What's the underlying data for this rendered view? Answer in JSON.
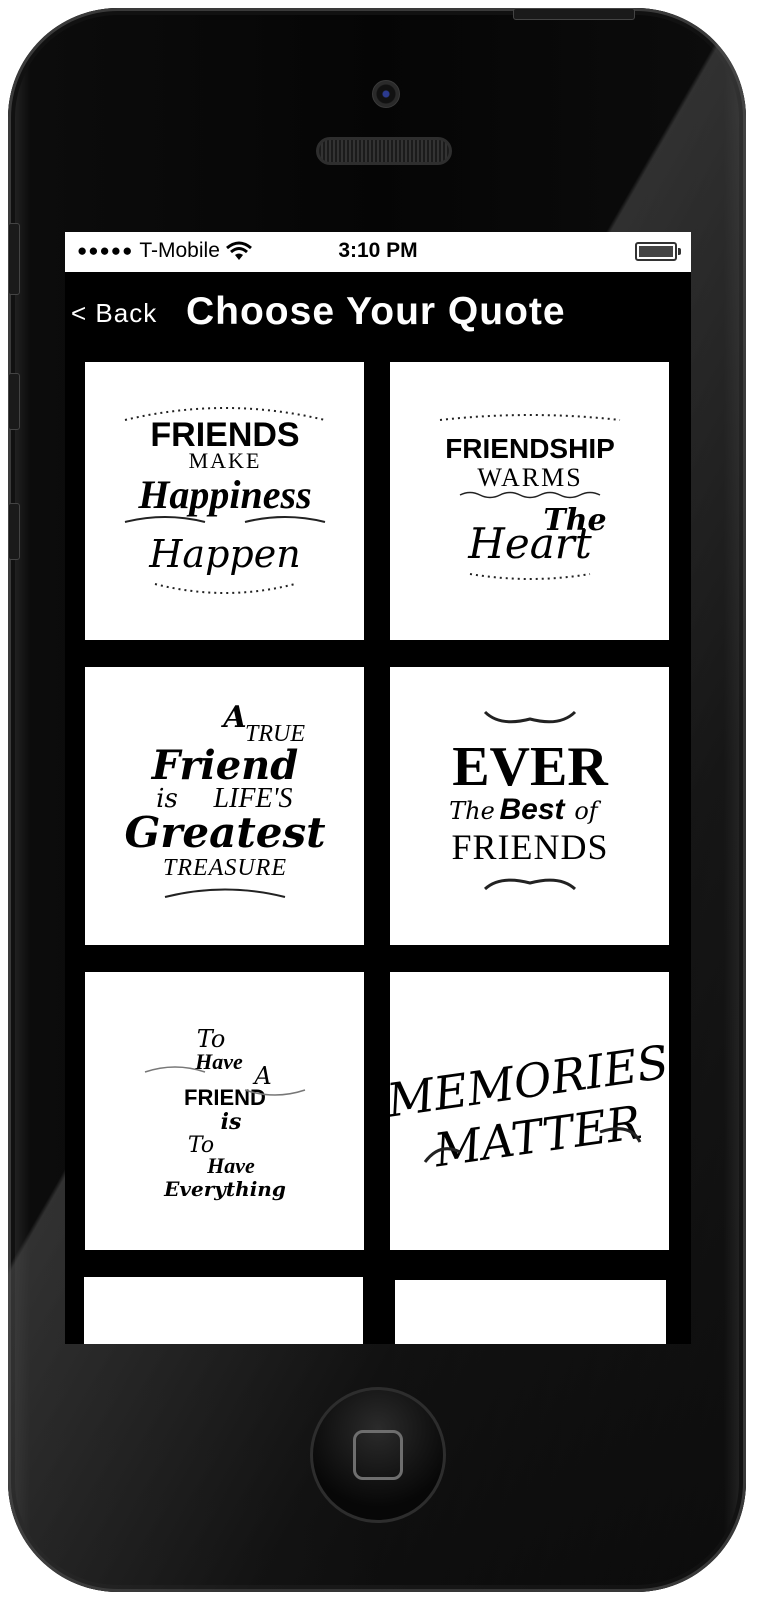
{
  "status_bar": {
    "signal": "●●●●●",
    "carrier": "T-Mobile",
    "wifi_icon": "wifi-icon",
    "time": "3:10 PM",
    "battery_icon": "battery-icon"
  },
  "nav": {
    "back_label": "< Back",
    "title": "Choose Your Quote"
  },
  "quotes": [
    {
      "lines": [
        "FRIENDS",
        "MAKE",
        "Happiness",
        "Happen"
      ]
    },
    {
      "lines": [
        "FRIENDSHIP",
        "WARMS",
        "The",
        "Heart"
      ]
    },
    {
      "lines": [
        "A",
        "TRUE",
        "Friend",
        "is",
        "LIFE'S",
        "Greatest",
        "TREASURE"
      ]
    },
    {
      "lines": [
        "EVER",
        "The",
        "Best",
        "of",
        "FRIENDS"
      ]
    },
    {
      "lines": [
        "To",
        "Have",
        "A",
        "FRIEND",
        "is",
        "To",
        "Have",
        "Everything"
      ]
    },
    {
      "lines": [
        "MEMORIES",
        "MATTER"
      ]
    },
    {
      "lines": []
    },
    {
      "lines": []
    }
  ],
  "colors": {
    "screen_bg": "#000000",
    "tile_bg": "#ffffff",
    "nav_text": "#ffffff"
  }
}
